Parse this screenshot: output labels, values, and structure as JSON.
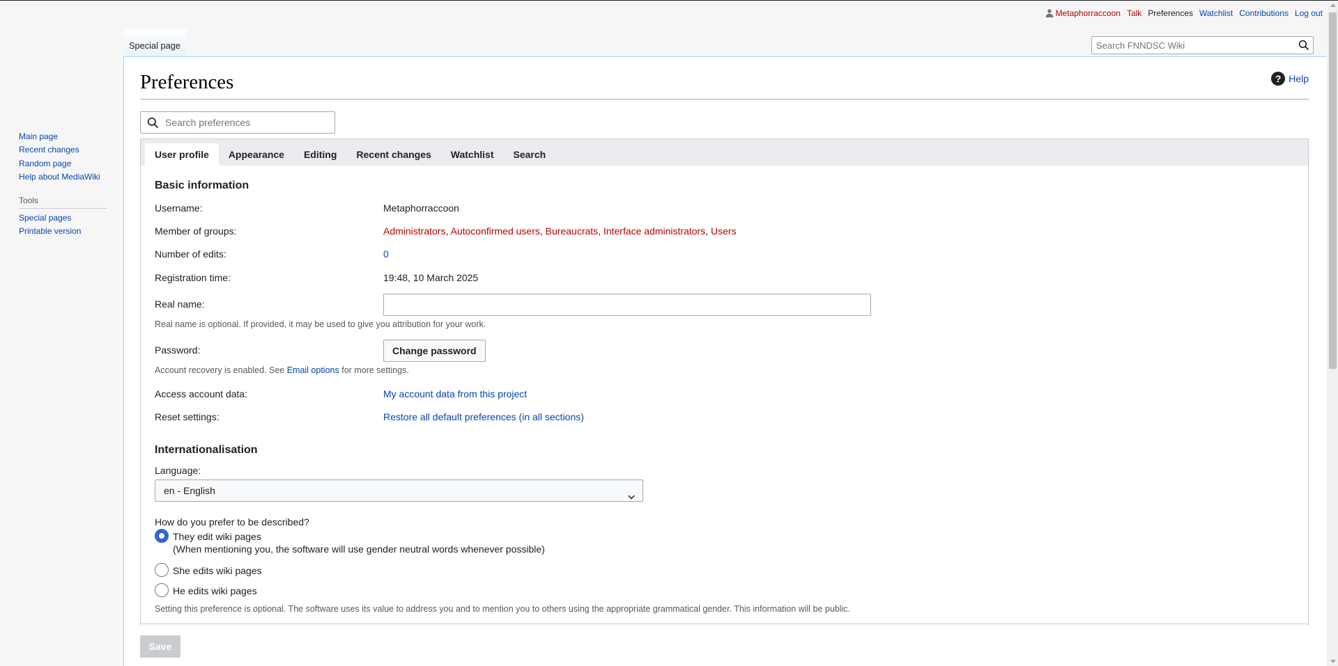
{
  "personal": {
    "username": "Metaphorraccoon",
    "talk": "Talk",
    "preferences": "Preferences",
    "watchlist": "Watchlist",
    "contributions": "Contributions",
    "logout": "Log out"
  },
  "sidebar": {
    "nav": [
      "Main page",
      "Recent changes",
      "Random page",
      "Help about MediaWiki"
    ],
    "tools_heading": "Tools",
    "tools": [
      "Special pages",
      "Printable version"
    ]
  },
  "head": {
    "tab": "Special page",
    "search_placeholder": "Search FNNDSC Wiki"
  },
  "page": {
    "title": "Preferences",
    "help": "Help",
    "pref_search_placeholder": "Search preferences"
  },
  "tabs": [
    "User profile",
    "Appearance",
    "Editing",
    "Recent changes",
    "Watchlist",
    "Search"
  ],
  "basic": {
    "heading": "Basic information",
    "username_label": "Username:",
    "username_value": "Metaphorraccoon",
    "groups_label": "Member of groups:",
    "groups": [
      "Administrators",
      "Autoconfirmed users",
      "Bureaucrats",
      "Interface administrators",
      "Users"
    ],
    "edits_label": "Number of edits:",
    "edits_value": "0",
    "reg_label": "Registration time:",
    "reg_value": "19:48, 10 March 2025",
    "realname_label": "Real name:",
    "realname_value": "",
    "realname_help": "Real name is optional. If provided, it may be used to give you attribution for your work.",
    "password_label": "Password:",
    "change_password": "Change password",
    "recovery_pre": "Account recovery is enabled. See ",
    "recovery_link": "Email options",
    "recovery_post": " for more settings.",
    "access_label": "Access account data:",
    "access_link": "My account data from this project",
    "reset_label": "Reset settings:",
    "reset_link": "Restore all default preferences (in all sections)"
  },
  "i18n": {
    "heading": "Internationalisation",
    "language_label": "Language:",
    "language_value": "en - English",
    "gender_question": "How do you prefer to be described?",
    "gender_neutral": "They edit wiki pages",
    "gender_neutral_note": "(When mentioning you, the software will use gender neutral words whenever possible)",
    "gender_female": "She edits wiki pages",
    "gender_male": "He edits wiki pages",
    "gender_help": "Setting this preference is optional. The software uses its value to address you and to mention you to others using the appropriate grammatical gender. This information will be public."
  },
  "save": "Save",
  "colors": {
    "link": "#0645ad",
    "redlink": "#ba0000",
    "accent": "#3366cc"
  }
}
